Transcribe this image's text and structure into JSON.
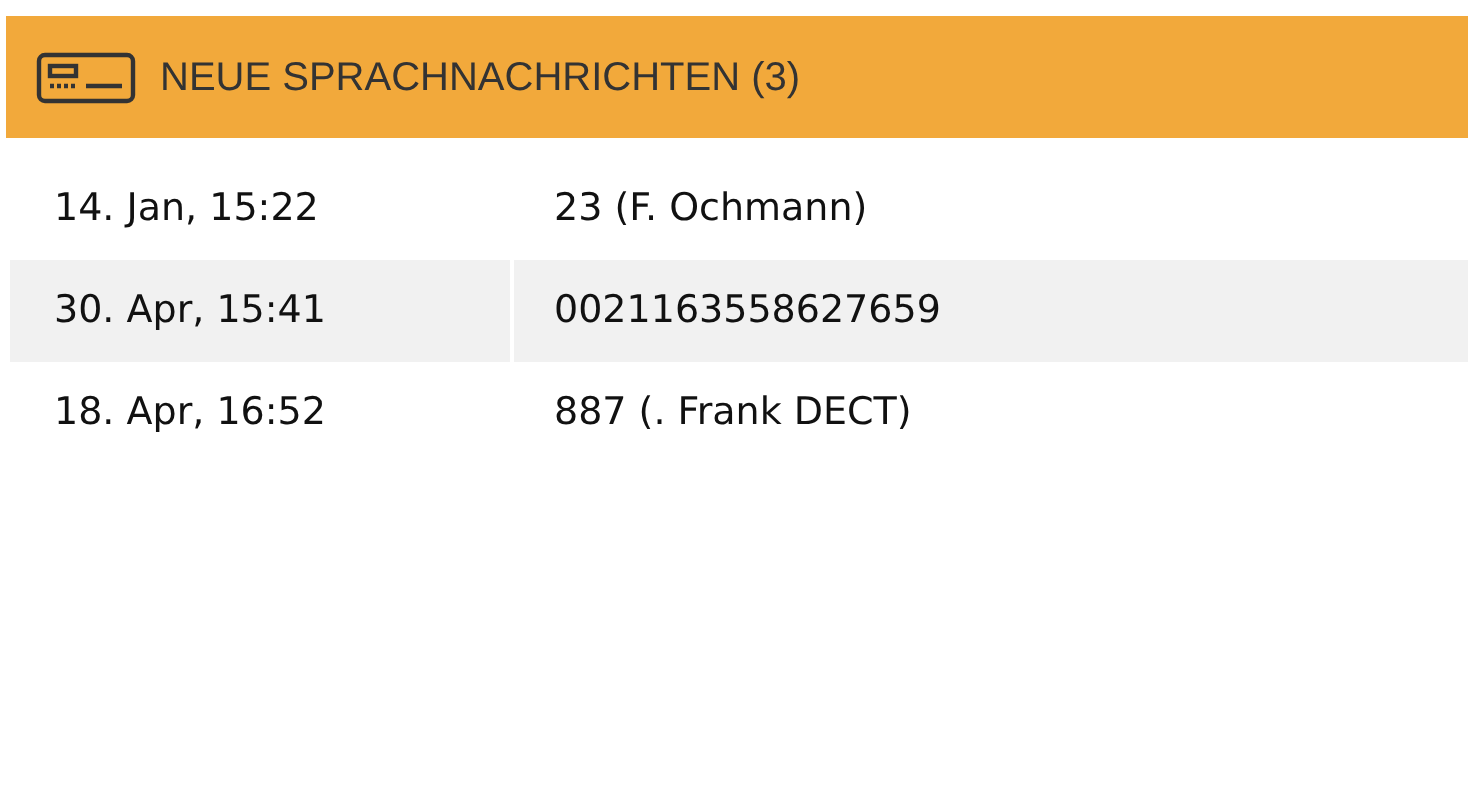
{
  "panel": {
    "title": "NEUE SPRACHNACHRICHTEN (3)"
  },
  "messages": [
    {
      "time": "14. Jan, 15:22",
      "caller": "23 (F. Ochmann)"
    },
    {
      "time": "30. Apr, 15:41",
      "caller": "0021163558627659"
    },
    {
      "time": "18. Apr, 16:52",
      "caller": "887 (. Frank DECT)"
    }
  ]
}
